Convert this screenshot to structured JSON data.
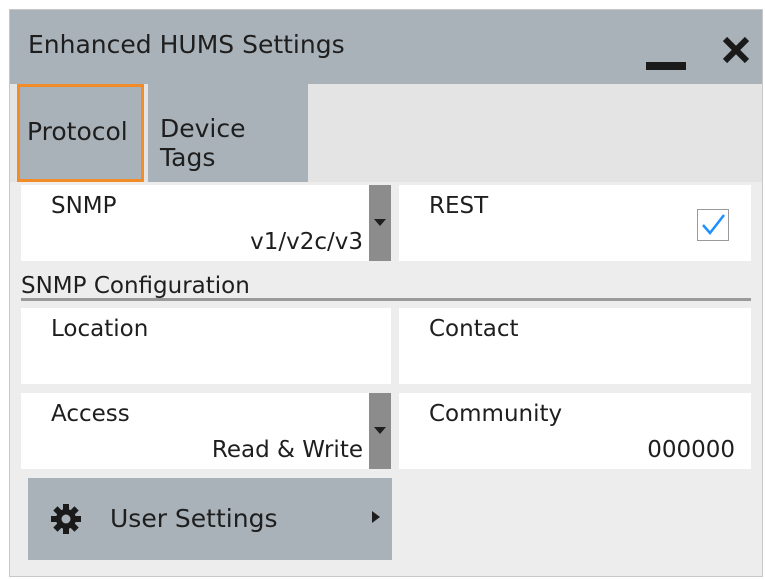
{
  "window": {
    "title": "Enhanced HUMS Settings",
    "minimize_icon": "minimize-icon",
    "close_icon": "close-icon"
  },
  "tabs": [
    {
      "label": "Protocol",
      "active": true
    },
    {
      "label": "Device Tags",
      "active": false
    }
  ],
  "protocol": {
    "snmp": {
      "label": "SNMP",
      "value": "v1/v2c/v3"
    },
    "rest": {
      "label": "REST",
      "checked": true
    },
    "section_title": "SNMP Configuration",
    "location": {
      "label": "Location",
      "value": ""
    },
    "contact": {
      "label": "Contact",
      "value": ""
    },
    "access": {
      "label": "Access",
      "value": "Read & Write"
    },
    "community": {
      "label": "Community",
      "value": "000000"
    },
    "user_settings": {
      "label": "User Settings",
      "icon": "gear-icon"
    }
  },
  "colors": {
    "titlebar": "#a9b2b9",
    "panel": "#ededed",
    "active_tab_border": "#f28c28",
    "checkmark": "#1e90ff"
  }
}
